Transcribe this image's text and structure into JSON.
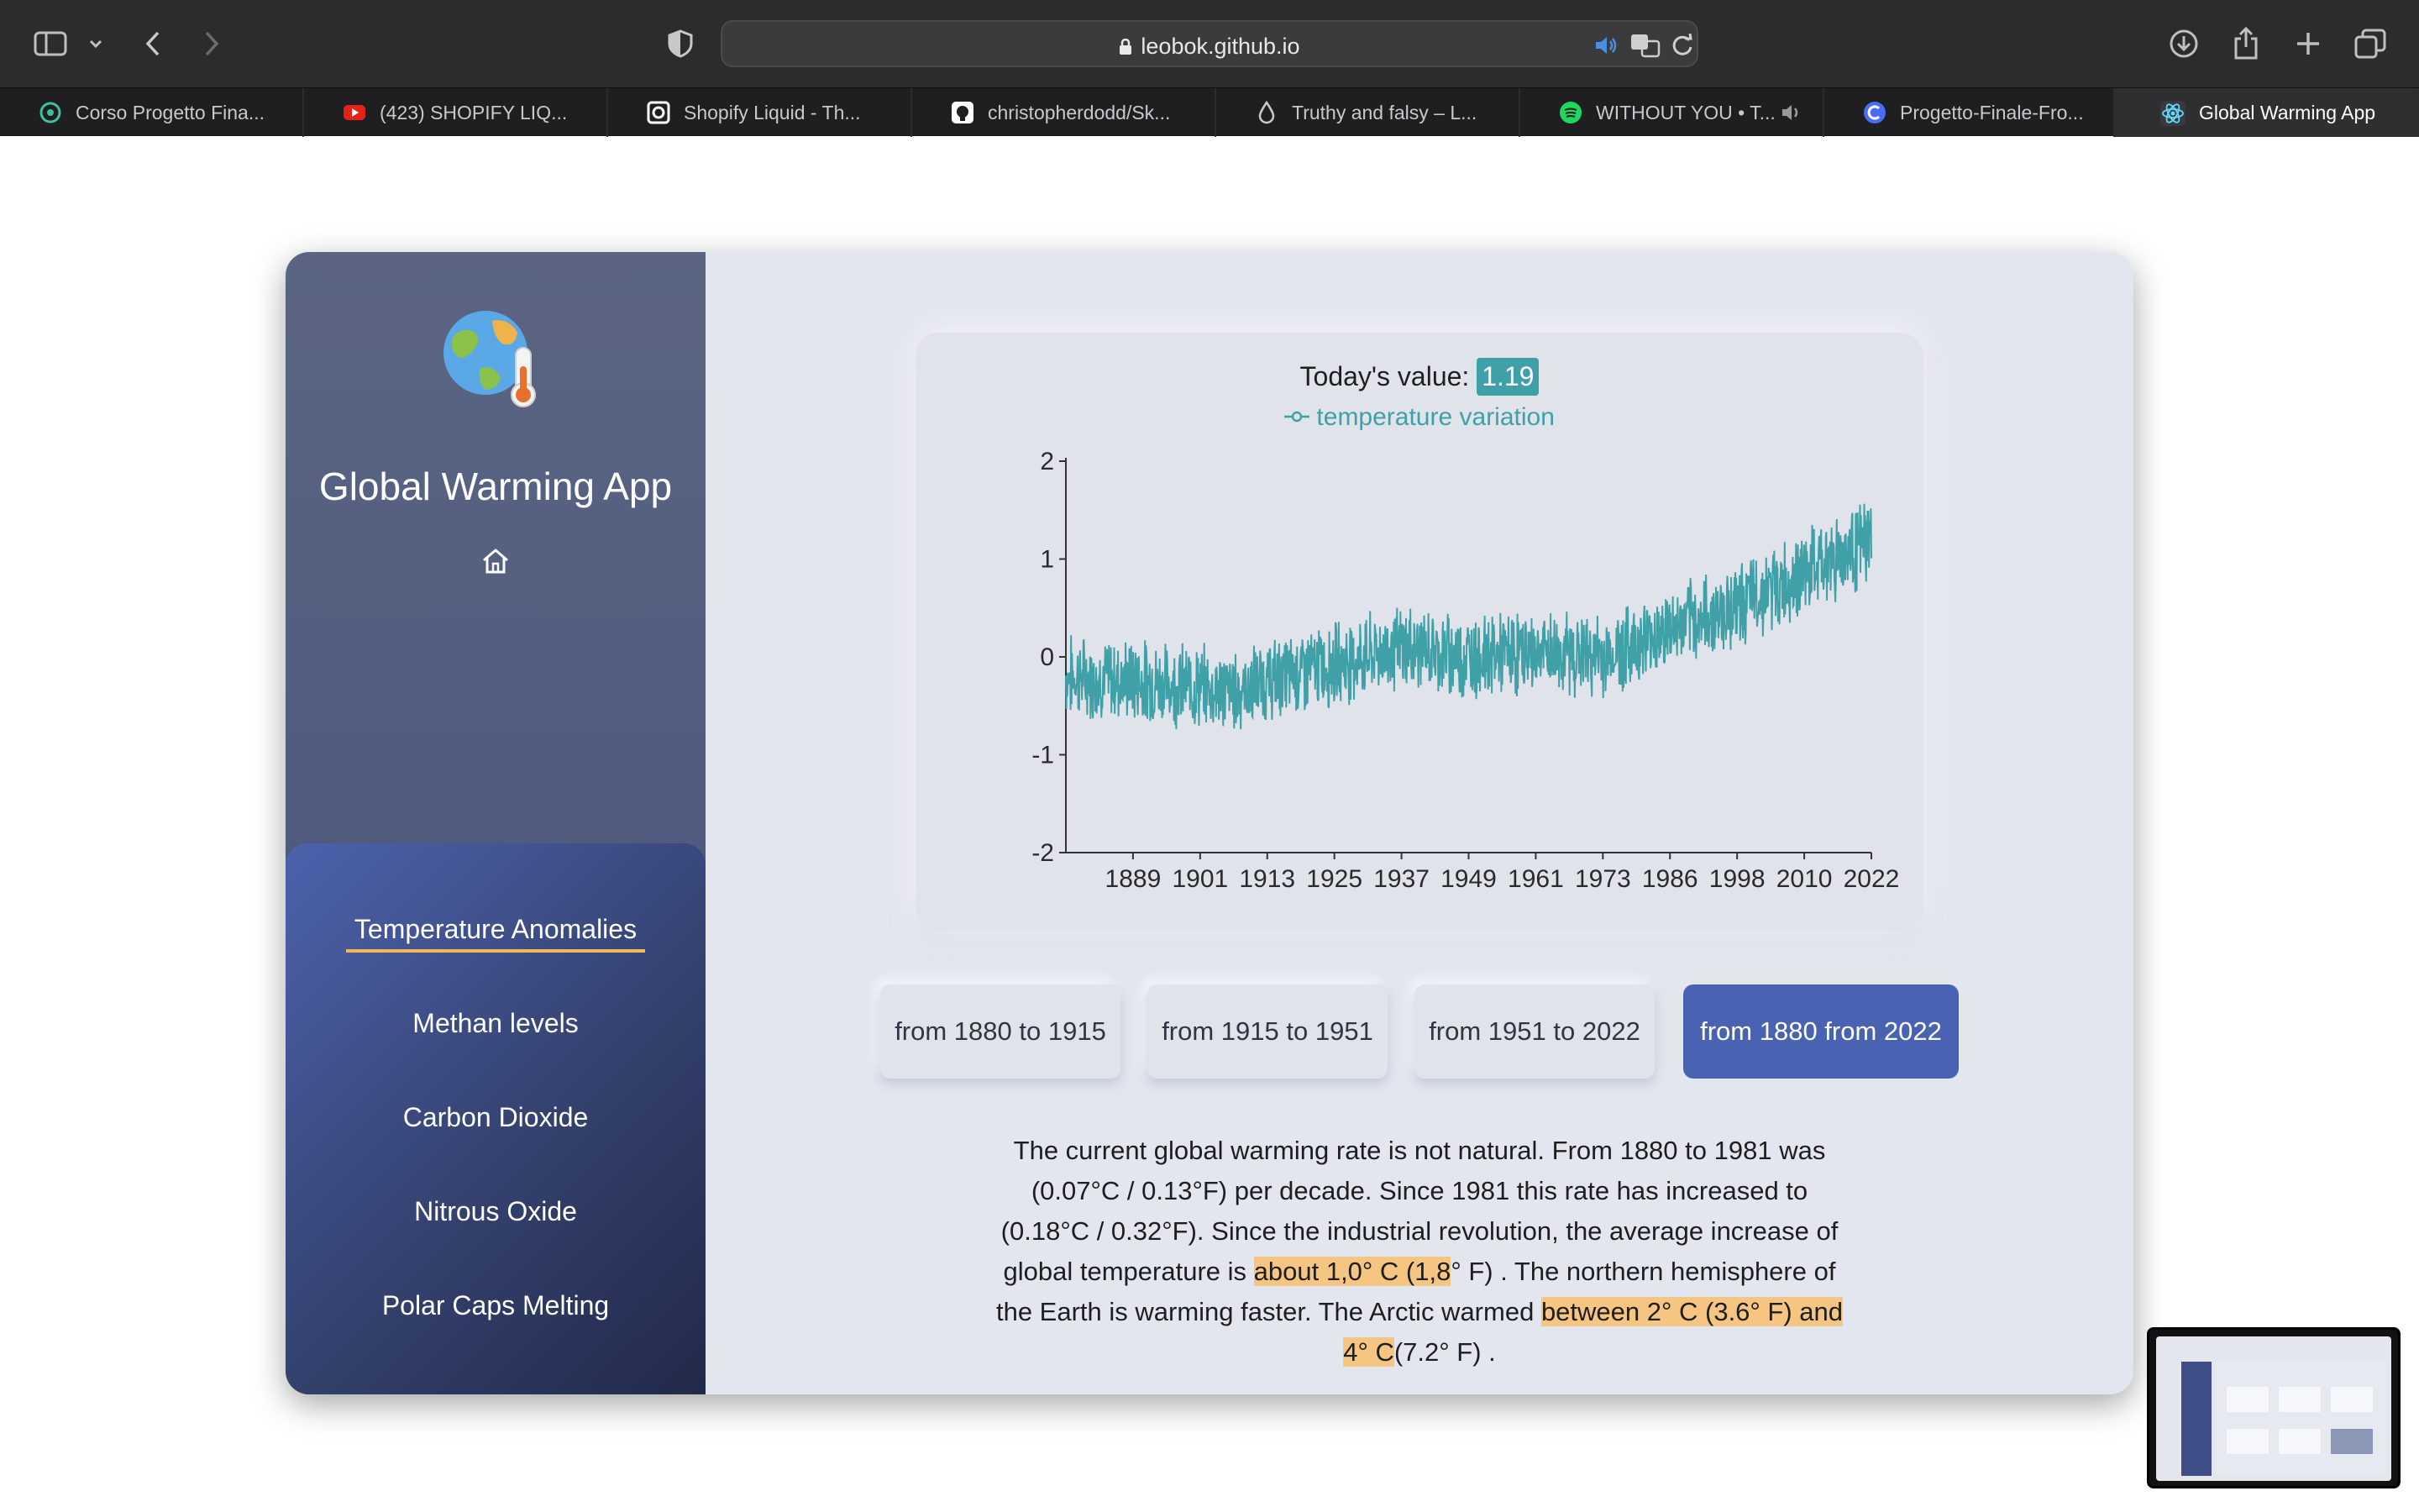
{
  "browser": {
    "url": "leobok.github.io",
    "tabs": [
      {
        "label": "Corso Progetto Fina...",
        "icon": "swirl-icon"
      },
      {
        "label": "(423) SHOPIFY LIQ...",
        "icon": "youtube-icon"
      },
      {
        "label": "Shopify Liquid - Th...",
        "icon": "square-o-icon"
      },
      {
        "label": "christopherdodd/Sk...",
        "icon": "github-icon"
      },
      {
        "label": "Truthy and falsy – L...",
        "icon": "drop-icon"
      },
      {
        "label": "WITHOUT YOU • T...",
        "icon": "spotify-icon"
      },
      {
        "label": "Progetto-Finale-Fro...",
        "icon": "c-icon"
      },
      {
        "label": "Global Warming App",
        "icon": "react-icon"
      }
    ]
  },
  "sidebar": {
    "title": "Global Warming App",
    "nav": [
      {
        "label": "Temperature Anomalies",
        "active": true
      },
      {
        "label": "Methan levels"
      },
      {
        "label": "Carbon Dioxide"
      },
      {
        "label": "Nitrous Oxide"
      },
      {
        "label": "Polar Caps Melting"
      }
    ]
  },
  "chart": {
    "today_label": "Today's value:",
    "today_value": "1.19",
    "accent": "#3fa0a8"
  },
  "chart_data": {
    "type": "line",
    "series": [
      {
        "name": "temperature variation"
      }
    ],
    "ylim": [
      -2,
      2
    ],
    "yticks": [
      "2",
      "1",
      "0",
      "-1",
      "-2"
    ],
    "xticks": [
      "1889",
      "1901",
      "1913",
      "1925",
      "1937",
      "1949",
      "1961",
      "1973",
      "1986",
      "1998",
      "2010",
      "2022"
    ],
    "trend_points": [
      [
        1880,
        -0.2
      ],
      [
        1895,
        -0.25
      ],
      [
        1910,
        -0.35
      ],
      [
        1925,
        -0.1
      ],
      [
        1940,
        0.1
      ],
      [
        1950,
        0.0
      ],
      [
        1965,
        0.05
      ],
      [
        1975,
        0.0
      ],
      [
        1985,
        0.25
      ],
      [
        1995,
        0.45
      ],
      [
        2005,
        0.7
      ],
      [
        2015,
        1.0
      ],
      [
        2022,
        1.19
      ]
    ],
    "grid": false
  },
  "ranges": [
    {
      "label": "from 1880 to 1915"
    },
    {
      "label": "from 1915 to 1951"
    },
    {
      "label": "from 1951 to 2022"
    },
    {
      "label": "from 1880 from 2022",
      "active": true
    }
  ],
  "description": {
    "p1": "The current global warming rate is not natural. From 1880 to 1981 was (0.07°C / 0.13°F) per decade. Since 1981 this rate has increased to (0.18°C / 0.32°F). Since the industrial revolution, the average increase of global temperature is ",
    "hl1": "about 1,0° C (1,8",
    "p2": "° F) . The northern hemisphere of the Earth is warming faster. The Arctic warmed ",
    "hl2": " between 2° C (3.6° F) and 4° C",
    "p3": "(7.2° F) ."
  }
}
